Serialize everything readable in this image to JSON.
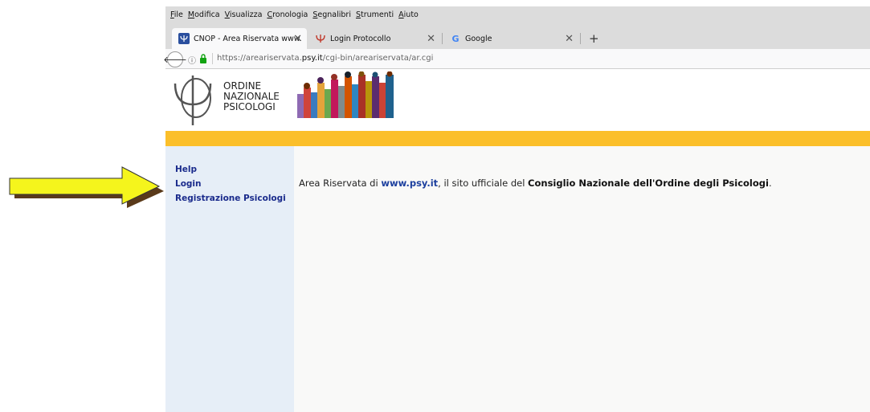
{
  "menu": [
    "File",
    "Modifica",
    "Visualizza",
    "Cronologia",
    "Segnalibri",
    "Strumenti",
    "Aiuto"
  ],
  "tabs": [
    {
      "title": "CNOP - Area Riservata www.",
      "active": true,
      "icon": "psi-icon"
    },
    {
      "title": "Login Protocollo",
      "active": false,
      "icon": "psi-icon"
    },
    {
      "title": "Google",
      "active": false,
      "icon": "google-icon"
    }
  ],
  "new_tab": "+",
  "address": {
    "prefix": "https://areariservata.",
    "domain": "psy.it",
    "path": "/cgi-bin/areariservata/ar.cgi"
  },
  "logo": {
    "line1": "ORDINE",
    "line2": "NAZIONALE",
    "line3": "PSICOLOGI"
  },
  "sidebar": [
    {
      "label": "Help"
    },
    {
      "label": "Login"
    },
    {
      "label": "Registrazione Psicologi"
    }
  ],
  "content": {
    "pre": "Area Riservata di ",
    "site": "www.psy.it",
    "mid": ", il sito ufficiale del ",
    "org": "Consiglio Nazionale dell'Ordine degli Psicologi",
    "post": "."
  },
  "colors": {
    "orange_bar": "#fbbf2a",
    "sidebar_bg": "#e6eef7",
    "link": "#1a2b8c",
    "arrow": "#f5f51c"
  }
}
